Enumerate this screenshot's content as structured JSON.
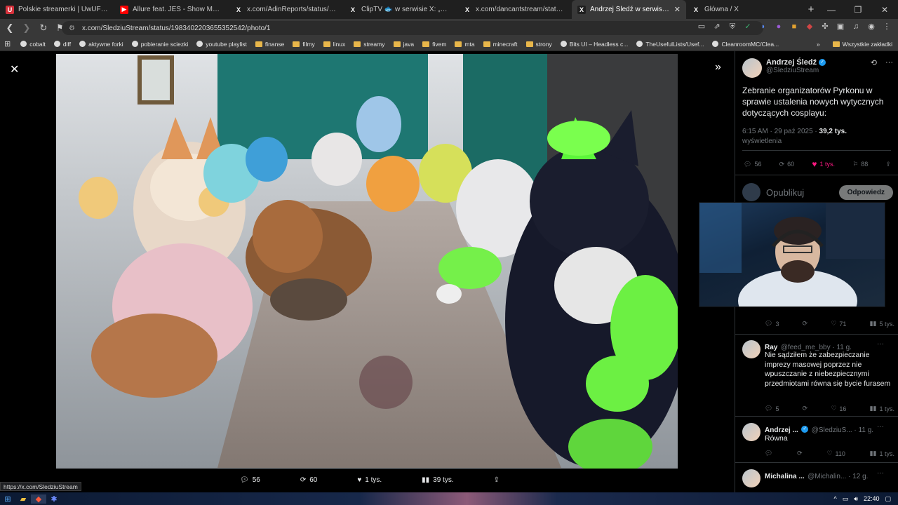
{
  "tabs": [
    {
      "label": "Polskie streamerki | UwUFUFU",
      "fav_color": "#d6323c",
      "fav_glyph": "U"
    },
    {
      "label": "Allure feat. JES - Show Me the W",
      "fav_color": "#ff0000",
      "fav_glyph": "▶"
    },
    {
      "label": "x.com/AdinReports/status/19833502",
      "fav_color": "#1f1f1f",
      "fav_glyph": "X"
    },
    {
      "label": "ClipTV 🐟 w serwisie X: „Adin Ross c",
      "fav_color": "#1f1f1f",
      "fav_glyph": "X"
    },
    {
      "label": "x.com/dancantstream/status/198333",
      "fav_color": "#1f1f1f",
      "fav_glyph": "X"
    },
    {
      "label": "Andrzej Śledź w serwisie X: „Zeb",
      "fav_color": "#1f1f1f",
      "fav_glyph": "X",
      "active": true
    },
    {
      "label": "Główna / X",
      "fav_color": "#1f1f1f",
      "fav_glyph": "X"
    }
  ],
  "address": {
    "url": "x.com/SledziuStream/status/1983402203655352542/photo/1"
  },
  "bookmarks": [
    {
      "label": "cobalt",
      "icon": "cobalt-icon"
    },
    {
      "label": "diff",
      "icon": "diff-icon"
    },
    {
      "label": "aktywne forki",
      "icon": "fork-icon"
    },
    {
      "label": "pobieranie sciezki",
      "icon": "download-icon"
    },
    {
      "label": "youtube playlist",
      "icon": "gear-icon"
    },
    {
      "label": "finanse",
      "icon": "folder-icon"
    },
    {
      "label": "filmy",
      "icon": "folder-icon"
    },
    {
      "label": "linux",
      "icon": "folder-icon"
    },
    {
      "label": "streamy",
      "icon": "folder-icon"
    },
    {
      "label": "java",
      "icon": "folder-icon"
    },
    {
      "label": "fivem",
      "icon": "folder-icon"
    },
    {
      "label": "mta",
      "icon": "folder-icon"
    },
    {
      "label": "minecraft",
      "icon": "folder-icon"
    },
    {
      "label": "strony",
      "icon": "folder-icon"
    },
    {
      "label": "Bits UI – Headless c...",
      "icon": "circle-icon"
    },
    {
      "label": "TheUsefulLists/Usef...",
      "icon": "github-icon"
    },
    {
      "label": "CleanroomMC/Clea...",
      "icon": "github-icon"
    }
  ],
  "bookmarks_more": "»",
  "all_bookmarks": "Wszystkie zakładki",
  "photo_stats": {
    "replies": "56",
    "reposts": "60",
    "likes": "1 tys.",
    "views": "39 tys."
  },
  "tweet": {
    "name": "Andrzej Śledź",
    "handle": "@SledziuStream",
    "text": "Zebranie organizatorów Pyrkonu w sprawie ustalenia nowych wytycznych dotyczących cosplayu:",
    "time": "6:15 AM · 29 paź 2025 · ",
    "views_num": "39,2 tys.",
    "views_label": "wyświetlenia",
    "replies": "56",
    "reposts": "60",
    "likes": "1 tys.",
    "bookmarks": "88"
  },
  "compose": {
    "placeholder": "Opublikuj",
    "button": "Odpowiedz"
  },
  "reply_stats_0": {
    "replies": "3",
    "likes": "71",
    "views": "5 tys."
  },
  "replies": [
    {
      "name": "Ray",
      "handle": "@feed_me_bby · 11 g.",
      "text": "Nie sądziłem że zabezpieczanie imprezy masowej poprzez nie wpuszczanie z niebezpiecznymi przedmiotami równa się bycie furasem",
      "replies": "5",
      "likes": "16",
      "views": "1 tys."
    },
    {
      "name": "Andrzej ...",
      "handle": "@SledziuS... · 11 g.",
      "text": "Równa",
      "replies": "",
      "likes": "110",
      "views": "1 tys."
    },
    {
      "name": "Michalina ...",
      "handle": "@Michalin... · 12 g.",
      "text": ""
    }
  ],
  "status_url": "https://x.com/SledziuStream",
  "clock": "22:40",
  "colors": {
    "accent": "#1d9bf0",
    "like": "#f91880",
    "tab_bg": "#1f1f1f",
    "toolbar_bg": "#383838"
  }
}
